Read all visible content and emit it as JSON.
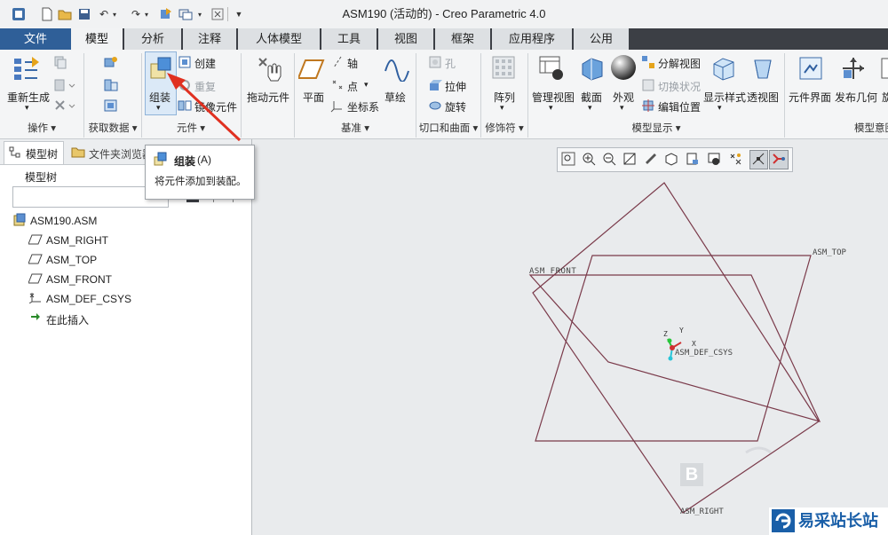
{
  "window": {
    "title": "ASM190 (活动的) - Creo Parametric 4.0"
  },
  "menu_tabs": [
    "文件",
    "模型",
    "分析",
    "注释",
    "人体模型",
    "工具",
    "视图",
    "框架",
    "应用程序",
    "公用"
  ],
  "ribbon": {
    "regenerate": "重新生成",
    "group_operations": "操作",
    "group_get_data": "获取数据",
    "assemble": "组装",
    "create": "创建",
    "repeat": "重复",
    "mirror_component": "镜像元件",
    "group_component": "元件",
    "drag_components": "拖动元件",
    "plane": "平面",
    "axis": "轴",
    "point": "点",
    "csys": "坐标系",
    "sketch": "草绘",
    "group_datum": "基准",
    "hole": "孔",
    "extrude": "拉伸",
    "revolve": "旋转",
    "group_cuts": "切口和曲面",
    "pattern": "阵列",
    "group_modifiers": "修饰符",
    "manage_views": "管理视图",
    "section": "截面",
    "appearance": "外观",
    "exploded_view": "分解视图",
    "toggle_status": "切换状况",
    "edit_position": "编辑位置",
    "display_style": "显示样式",
    "perspective": "透视图",
    "group_model_display": "模型显示",
    "component_interface": "元件界面",
    "publish_geometry": "发布几何",
    "rotate_partial": "旋",
    "group_model_intent": "模型意图"
  },
  "left_panel": {
    "tab_model_tree": "模型树",
    "tab_folder_browser": "文件夹浏览器",
    "header": "模型树",
    "tree": [
      {
        "label": "ASM190.ASM",
        "icon": "assembly-icon"
      },
      {
        "label": "ASM_RIGHT",
        "icon": "datum-plane-icon"
      },
      {
        "label": "ASM_TOP",
        "icon": "datum-plane-icon"
      },
      {
        "label": "ASM_FRONT",
        "icon": "datum-plane-icon"
      },
      {
        "label": "ASM_DEF_CSYS",
        "icon": "csys-icon"
      },
      {
        "label": "在此插入",
        "icon": "insert-here-icon"
      }
    ]
  },
  "tooltip": {
    "title": "组装",
    "shortcut": "(A)",
    "description": "将元件添加到装配。"
  },
  "viewport": {
    "plane_labels": [
      "ASM_FRONT",
      "ASM_TOP",
      "ASM_RIGHT"
    ],
    "csys_label": "ASM_DEF_CSYS",
    "axis_x": "X",
    "axis_y": "Y",
    "axis_z": "Z"
  },
  "watermark": {
    "brand": "易采站长站"
  },
  "colors": {
    "tab_bar": "#3c3f45",
    "datum_plane": "#7a3a4a",
    "annotation_arrow": "#e03020"
  }
}
